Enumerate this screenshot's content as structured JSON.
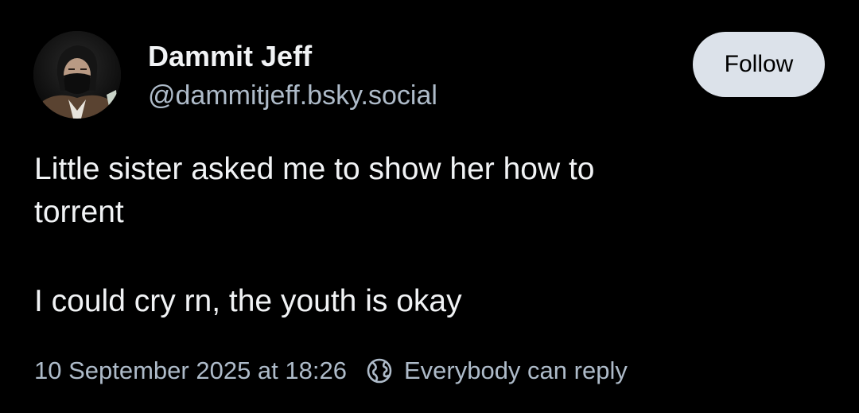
{
  "post": {
    "author": {
      "display_name": "Dammit Jeff",
      "handle": "@dammitjeff.bsky.social"
    },
    "follow_label": "Follow",
    "text_lines": [
      "Little sister asked me to show her how to",
      "torrent",
      "I could cry rn, the youth is okay"
    ],
    "timestamp": "10 September 2025 at 18:26",
    "reply_setting": "Everybody can reply",
    "reply_icon": "globe-earth-icon"
  },
  "colors": {
    "background": "#000000",
    "text": "#f1f3f5",
    "muted": "#aebbc9",
    "button_bg": "#dce2ea"
  }
}
